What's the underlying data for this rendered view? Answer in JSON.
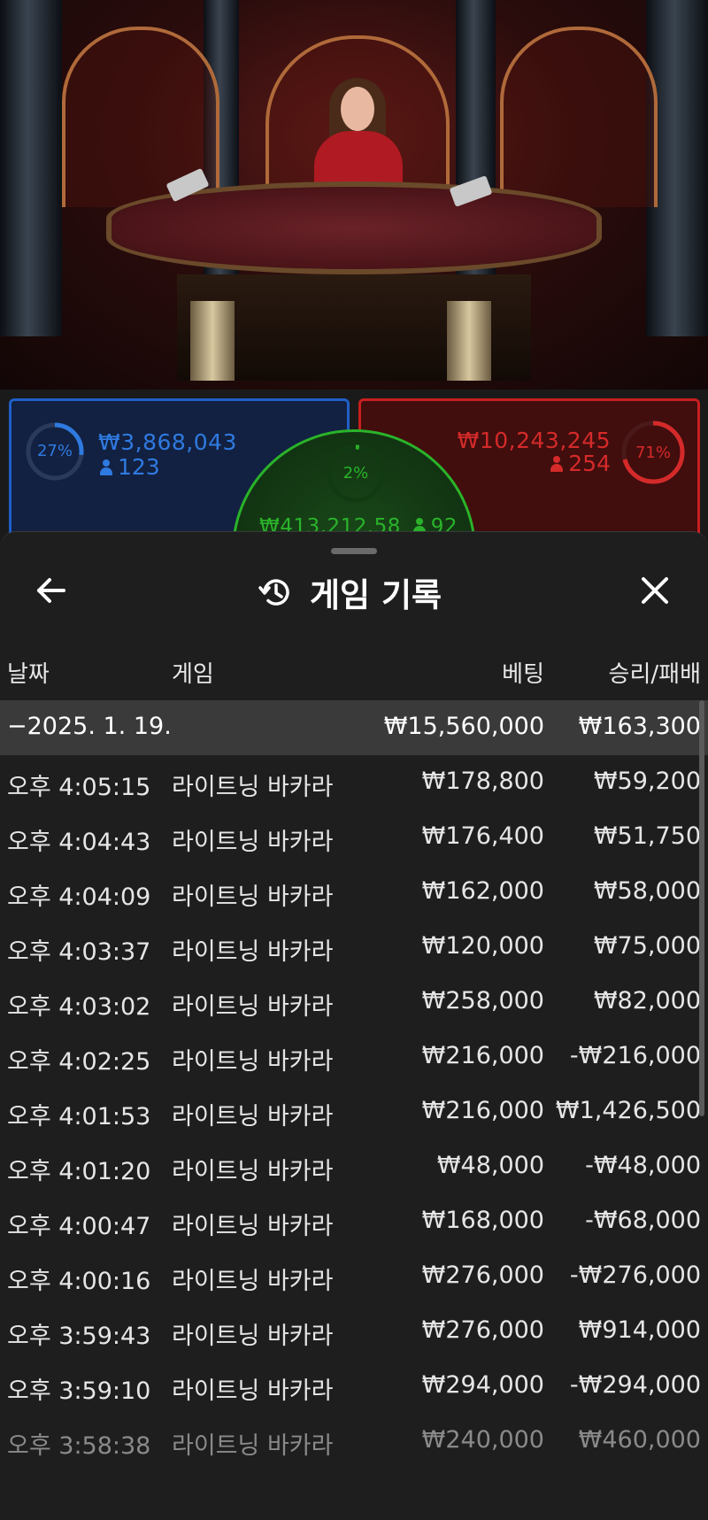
{
  "bets": {
    "player": {
      "percent": "27%",
      "amount": "₩3,868,043",
      "count": "123",
      "color": "#2f7ae0",
      "share": 0.27
    },
    "banker": {
      "percent": "71%",
      "amount": "₩10,243,245",
      "count": "254",
      "color": "#d42a2a",
      "share": 0.71
    },
    "tie": {
      "percent": "2%",
      "amount": "₩413,212.58",
      "count": "92",
      "color": "#2ab32a",
      "share": 0.02
    }
  },
  "history": {
    "title": "게임 기록",
    "columns": {
      "date": "날짜",
      "game": "게임",
      "bet": "베팅",
      "result": "승리/패배"
    },
    "summary": {
      "date": "−2025. 1. 19.",
      "bet": "₩15,560,000",
      "result": "₩163,300"
    },
    "rows": [
      {
        "time": "오후 4:05:15",
        "game": "라이트닝 바카라",
        "bet": "₩178,800",
        "result": "₩59,200"
      },
      {
        "time": "오후 4:04:43",
        "game": "라이트닝 바카라",
        "bet": "₩176,400",
        "result": "₩51,750"
      },
      {
        "time": "오후 4:04:09",
        "game": "라이트닝 바카라",
        "bet": "₩162,000",
        "result": "₩58,000"
      },
      {
        "time": "오후 4:03:37",
        "game": "라이트닝 바카라",
        "bet": "₩120,000",
        "result": "₩75,000"
      },
      {
        "time": "오후 4:03:02",
        "game": "라이트닝 바카라",
        "bet": "₩258,000",
        "result": "₩82,000"
      },
      {
        "time": "오후 4:02:25",
        "game": "라이트닝 바카라",
        "bet": "₩216,000",
        "result": "-₩216,000"
      },
      {
        "time": "오후 4:01:53",
        "game": "라이트닝 바카라",
        "bet": "₩216,000",
        "result": "₩1,426,500"
      },
      {
        "time": "오후 4:01:20",
        "game": "라이트닝 바카라",
        "bet": "₩48,000",
        "result": "-₩48,000"
      },
      {
        "time": "오후 4:00:47",
        "game": "라이트닝 바카라",
        "bet": "₩168,000",
        "result": "-₩68,000"
      },
      {
        "time": "오후 4:00:16",
        "game": "라이트닝 바카라",
        "bet": "₩276,000",
        "result": "-₩276,000"
      },
      {
        "time": "오후 3:59:43",
        "game": "라이트닝 바카라",
        "bet": "₩276,000",
        "result": "₩914,000"
      },
      {
        "time": "오후 3:59:10",
        "game": "라이트닝 바카라",
        "bet": "₩294,000",
        "result": "-₩294,000"
      },
      {
        "time": "오후 3:58:38",
        "game": "라이트닝 바카라",
        "bet": "₩240,000",
        "result": "₩460,000"
      }
    ]
  },
  "icons": {
    "back": "arrow-left-icon",
    "history": "history-icon",
    "close": "close-icon"
  }
}
